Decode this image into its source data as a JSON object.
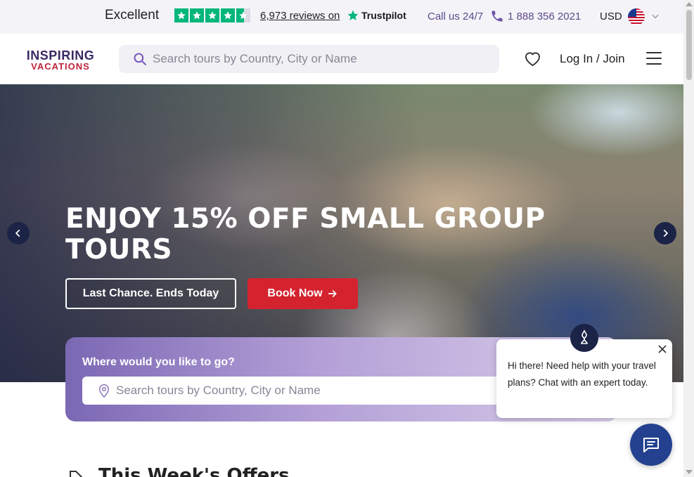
{
  "topbar": {
    "rating_label": "Excellent",
    "stars": 4.5,
    "reviews_text": "6,973 reviews on",
    "trustpilot_label": "Trustpilot",
    "call_label": "Call us 24/7",
    "phone": "1 888 356 2021",
    "currency": "USD",
    "colors": {
      "trustpilot_green": "#00b67a",
      "call_purple": "#5d4a8a"
    }
  },
  "header": {
    "logo_line1": "INSPIRING",
    "logo_line2": "VACATIONS",
    "search_placeholder": "Search tours by Country, City or Name",
    "login_label": "Log In / Join"
  },
  "hero": {
    "title": "ENJOY 15% OFF SMALL GROUP TOURS",
    "secondary_button": "Last Chance. Ends Today",
    "primary_button": "Book Now",
    "colors": {
      "book_red": "#d4232f",
      "arrow_navy": "#1b2347"
    }
  },
  "search_panel": {
    "label": "Where would you like to go?",
    "placeholder": "Search tours by Country, City or Name"
  },
  "offers": {
    "title": "This Week's Offers"
  },
  "chat": {
    "message": "Hi there! Need help with your travel plans? Chat with an expert today."
  }
}
